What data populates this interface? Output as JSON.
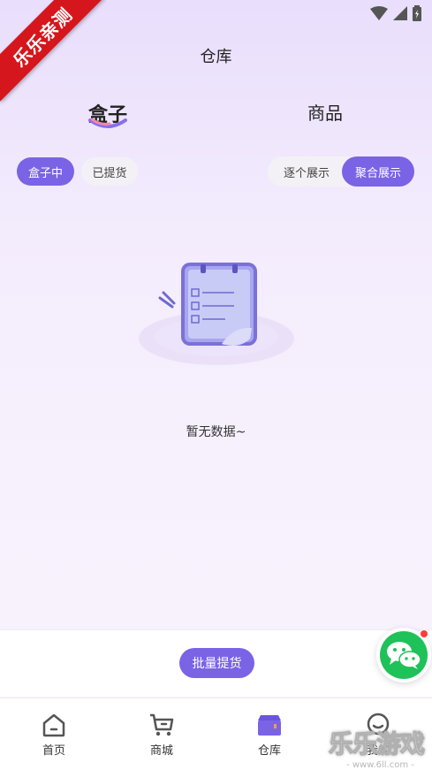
{
  "header": {
    "title": "仓库"
  },
  "ribbon": {
    "text": "乐乐亲测"
  },
  "main_tabs": [
    {
      "label": "盒子",
      "active": true
    },
    {
      "label": "商品",
      "active": false
    }
  ],
  "filters": {
    "status": [
      {
        "label": "盒子中",
        "active": true
      },
      {
        "label": "已提货",
        "active": false
      }
    ],
    "display_mode": [
      {
        "label": "逐个展示",
        "active": false
      },
      {
        "label": "聚合展示",
        "active": true
      }
    ]
  },
  "empty_state": {
    "text": "暂无数据~",
    "icon": "empty-notebook-icon"
  },
  "action_bar": {
    "batch_label": "批量提货"
  },
  "float_button": {
    "icon": "wechat-icon",
    "has_badge": true
  },
  "bottom_nav": [
    {
      "label": "首页",
      "icon": "home-icon",
      "active": false
    },
    {
      "label": "商城",
      "icon": "cart-icon",
      "active": false
    },
    {
      "label": "仓库",
      "icon": "warehouse-icon",
      "active": true
    },
    {
      "label": "我的",
      "icon": "profile-icon",
      "active": false
    }
  ],
  "watermark": {
    "big": "乐乐游戏",
    "small": "- www.6ll.com -"
  },
  "colors": {
    "accent": "#7b63e6",
    "ribbon": "#d5161c",
    "wechat": "#1fc159"
  }
}
